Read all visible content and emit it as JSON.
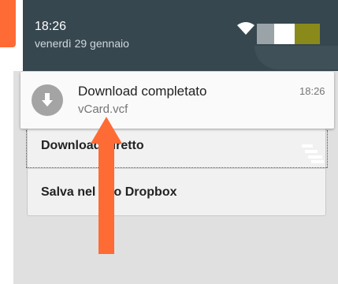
{
  "status_bar": {
    "time": "18:26",
    "date": "venerdì 29 gennaio"
  },
  "notification": {
    "title": "Download completato",
    "file": "vCard.vcf",
    "time": "18:26",
    "icon": "download-icon"
  },
  "menu": {
    "items": [
      {
        "label": "Download diretto"
      },
      {
        "label": "Salva nel mio Dropbox"
      }
    ]
  },
  "annotation": {
    "arrow_color": "#ff6b35"
  },
  "colors": {
    "shade": "#37474f",
    "accent": "#ff6b35",
    "notification_bg": "#fafafa"
  }
}
